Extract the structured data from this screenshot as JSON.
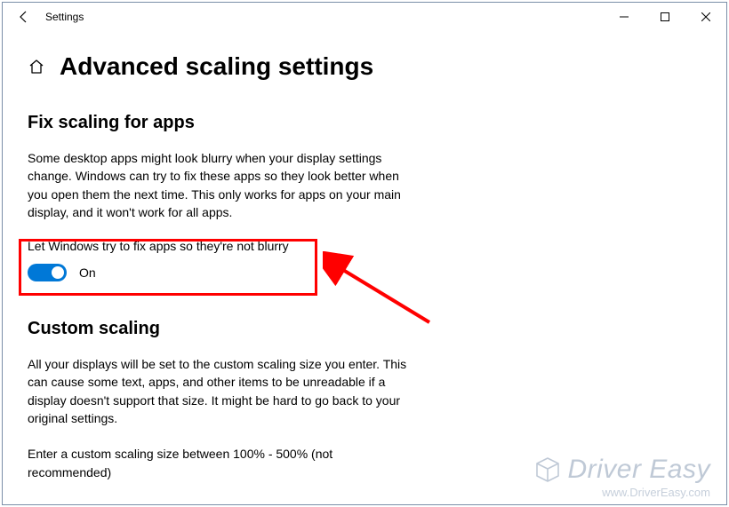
{
  "window": {
    "title": "Settings"
  },
  "page": {
    "title": "Advanced scaling settings"
  },
  "section1": {
    "heading": "Fix scaling for apps",
    "description": "Some desktop apps might look blurry when your display settings change. Windows can try to fix these apps so they look better when you open them the next time. This only works for apps on your main display, and it won't work for all apps.",
    "toggle_label": "Let Windows try to fix apps so they're not blurry",
    "toggle_state_text": "On",
    "toggle_on": true
  },
  "section2": {
    "heading": "Custom scaling",
    "description": "All your displays will be set to the custom scaling size you enter. This can cause some text, apps, and other items to be unreadable if a display doesn't support that size. It might be hard to go back to your original settings.",
    "hint": "Enter a custom scaling size between 100% - 500% (not recommended)"
  },
  "watermark": {
    "brand": "Driver Easy",
    "url": "www.DriverEasy.com"
  }
}
